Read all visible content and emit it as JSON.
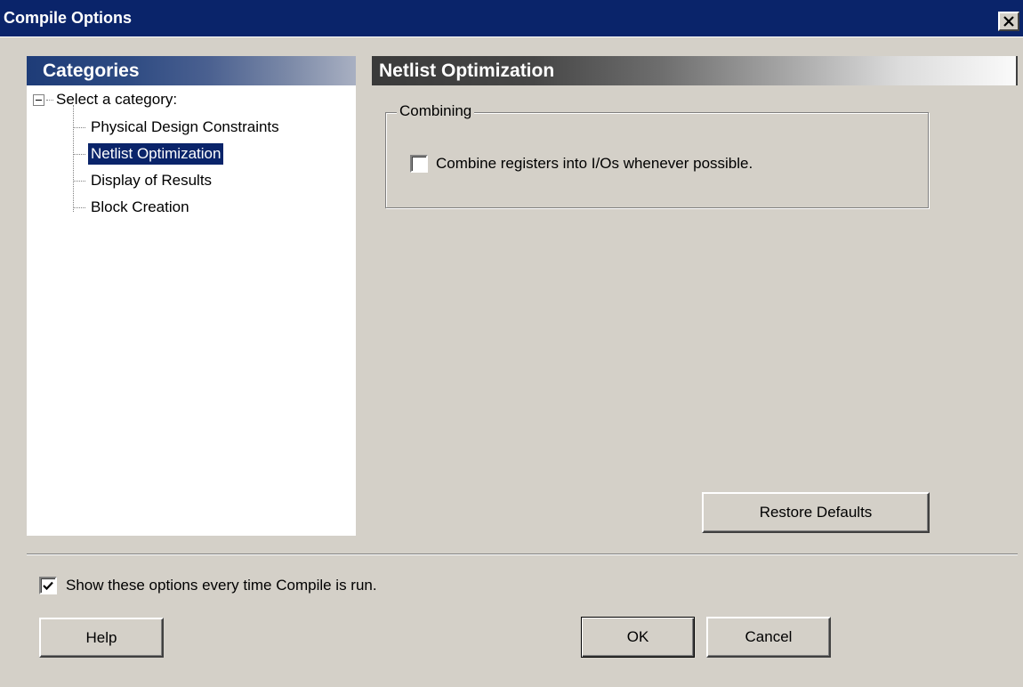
{
  "window": {
    "title": "Compile Options",
    "close_icon": "close-icon"
  },
  "categories": {
    "header": "Categories",
    "root_label": "Select a category:",
    "items": [
      {
        "label": "Physical Design Constraints",
        "selected": false
      },
      {
        "label": "Netlist Optimization",
        "selected": true
      },
      {
        "label": "Display of Results",
        "selected": false
      },
      {
        "label": "Block Creation",
        "selected": false
      }
    ]
  },
  "panel": {
    "header": "Netlist Optimization",
    "group_label": "Combining",
    "option_label": "Combine registers into I/Os whenever possible.",
    "option_checked": false,
    "restore_label": "Restore Defaults"
  },
  "footer": {
    "show_label": "Show these options every time Compile is run.",
    "show_checked": true,
    "help_label": "Help",
    "ok_label": "OK",
    "cancel_label": "Cancel"
  },
  "colors": {
    "titlebar": "#0a246a",
    "selection": "#0a246a",
    "face": "#d4d0c8"
  }
}
